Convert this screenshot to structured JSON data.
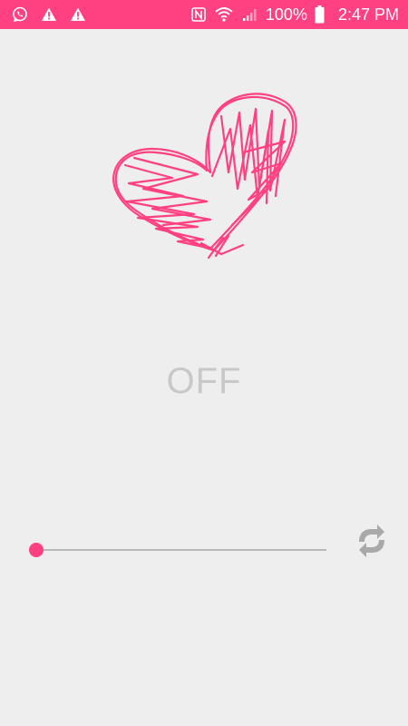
{
  "status_bar": {
    "battery_text": "100%",
    "time": "2:47 PM",
    "background_color": "#ff4081",
    "notification_icons": [
      "whatsapp-icon",
      "warning-icon",
      "warning-icon"
    ],
    "system_icons": [
      "nfc-icon",
      "wifi-icon",
      "signal-icon",
      "battery-icon"
    ]
  },
  "main": {
    "heart_icon": "scribble-heart-icon",
    "state_text": "OFF",
    "accent_color": "#ff4081",
    "state_text_color": "#c8c8c8",
    "slider": {
      "value_fraction": 0.0
    },
    "repeat_icon": "repeat-icon"
  }
}
